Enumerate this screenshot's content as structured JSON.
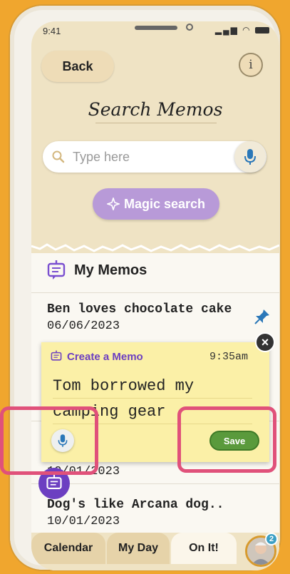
{
  "status": {
    "time": "9:41"
  },
  "header": {
    "back_label": "Back",
    "title": "Search Memos"
  },
  "search": {
    "placeholder": "Type here"
  },
  "magic": {
    "label": "Magic search"
  },
  "memos": {
    "title": "My Memos",
    "items": [
      {
        "text": "Ben loves chocolate cake",
        "date": "06/06/2023",
        "pinned": true
      },
      {
        "text": "",
        "date": "10/01/2023"
      },
      {
        "text": "Dog's like Arcana dog..",
        "date": "10/01/2023"
      }
    ]
  },
  "popup": {
    "title": "Create a Memo",
    "time": "9:35am",
    "text": "Tom borrowed my camping gear",
    "save_label": "Save"
  },
  "tabs": [
    {
      "label": "Calendar"
    },
    {
      "label": "My Day"
    },
    {
      "label": "On It!",
      "active": true
    }
  ],
  "avatar_badge": "2",
  "colors": {
    "accent_purple": "#6c3fc1",
    "save_green": "#5a9a3c",
    "highlight_pink": "#e0517a",
    "background_orange": "#F0A62E"
  }
}
